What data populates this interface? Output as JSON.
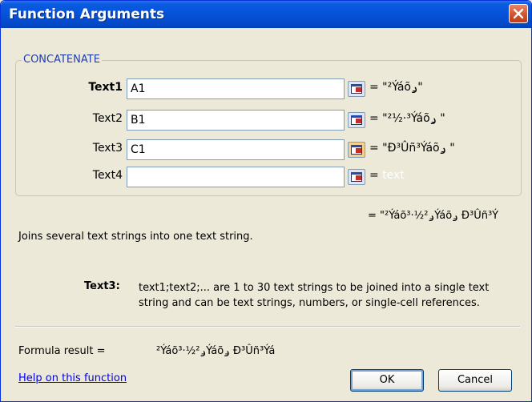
{
  "window": {
    "title": "Function Arguments"
  },
  "function": {
    "name": "CONCATENATE"
  },
  "arguments": [
    {
      "label": "Text1",
      "value": "A1",
      "result": "= \"²Ýáõݛ\""
    },
    {
      "label": "Text2",
      "value": "B1",
      "result": "= \"²½·³Ýáõݛ \""
    },
    {
      "label": "Text3",
      "value": "C1",
      "result": "= \"Ð³Ûñ³Ýáõݛ \""
    },
    {
      "label": "Text4",
      "value": "",
      "result_prefix": "=",
      "result_hint": "text"
    }
  ],
  "overall_result": "= \"²Ýáõݛ²½·³Ýáõݛ Ð³Ûñ³Ý",
  "description": "Joins several text strings into one text string.",
  "help": {
    "arg_name": "Text3:",
    "arg_text": "text1;text2;... are 1 to 30 text strings to be joined into a single text string and can be text strings, numbers, or single-cell references."
  },
  "formula_result": {
    "label": "Formula result =",
    "value": "²Ýáõݛ²½·³Ýáõݛ Ð³Ûñ³Ýá"
  },
  "links": {
    "help_label": "Help on this function"
  },
  "buttons": {
    "ok_label": "OK",
    "cancel_label": "Cancel"
  }
}
